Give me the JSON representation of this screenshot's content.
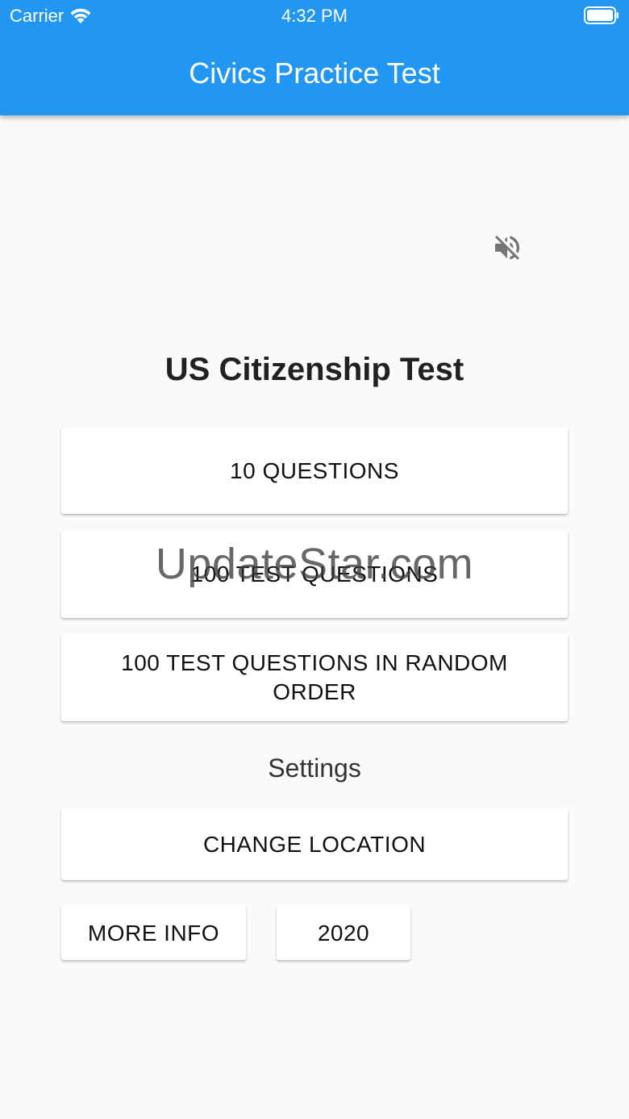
{
  "status_bar": {
    "carrier": "Carrier",
    "time": "4:32 PM"
  },
  "app_bar": {
    "title": "Civics Practice Test",
    "color": "#2196f3"
  },
  "mute_button": {
    "icon": "volume-off-icon"
  },
  "main": {
    "heading": "US Citizenship Test",
    "buttons": {
      "ten_questions": "10 QUESTIONS",
      "hundred_questions": "100 TEST QUESTIONS",
      "hundred_random": "100 TEST QUESTIONS IN RANDOM ORDER"
    },
    "settings_label": "Settings",
    "change_location": "CHANGE LOCATION",
    "more_info": "MORE INFO",
    "year": "2020"
  },
  "watermark": "UpdateStar.com"
}
